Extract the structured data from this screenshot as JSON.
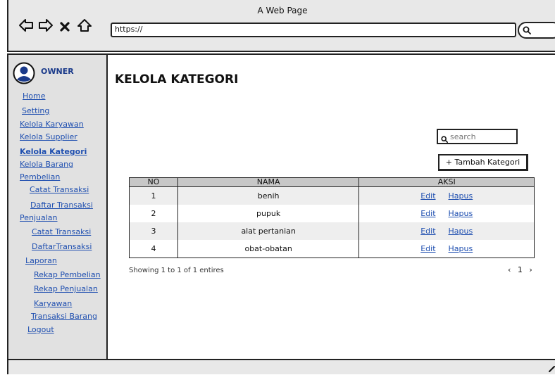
{
  "browser": {
    "title": "A Web Page",
    "url": "https://"
  },
  "sidebar": {
    "user": "OWNER",
    "items": [
      {
        "label": "Home"
      },
      {
        "label": "Setting"
      },
      {
        "label": "Kelola Karyawan"
      },
      {
        "label": "Kelola Supplier"
      },
      {
        "label": "Kelola Kategori",
        "active": true
      },
      {
        "label": "Kelola Barang"
      },
      {
        "label": "Pembelian"
      },
      {
        "label": "Catat Transaksi"
      },
      {
        "label": "Daftar Transaksi"
      },
      {
        "label": "Penjualan"
      },
      {
        "label": "Catat Transaksi"
      },
      {
        "label": "DaftarTransaksi"
      },
      {
        "label": "Laporan"
      },
      {
        "label": "Rekap Pembelian"
      },
      {
        "label": "Rekap Penjualan"
      },
      {
        "label": "Karyawan"
      },
      {
        "label": "Transaksi Barang"
      },
      {
        "label": "Logout"
      }
    ]
  },
  "main": {
    "title": "KELOLA KATEGORI",
    "search_placeholder": "search",
    "add_button": "+ Tambah Kategori",
    "table": {
      "headers": [
        "NO",
        "NAMA",
        "AKSI"
      ],
      "rows": [
        {
          "no": "1",
          "nama": "benih",
          "edit": "Edit",
          "hapus": "Hapus"
        },
        {
          "no": "2",
          "nama": "pupuk",
          "edit": "Edit",
          "hapus": "Hapus"
        },
        {
          "no": "3",
          "nama": "alat pertanian",
          "edit": "Edit",
          "hapus": "Hapus"
        },
        {
          "no": "4",
          "nama": "obat-obatan",
          "edit": "Edit",
          "hapus": "Hapus"
        }
      ]
    },
    "showing": "Showing 1 to 1 of 1 entires",
    "pagination": {
      "prev": "‹",
      "page": "1",
      "next": "›"
    }
  }
}
